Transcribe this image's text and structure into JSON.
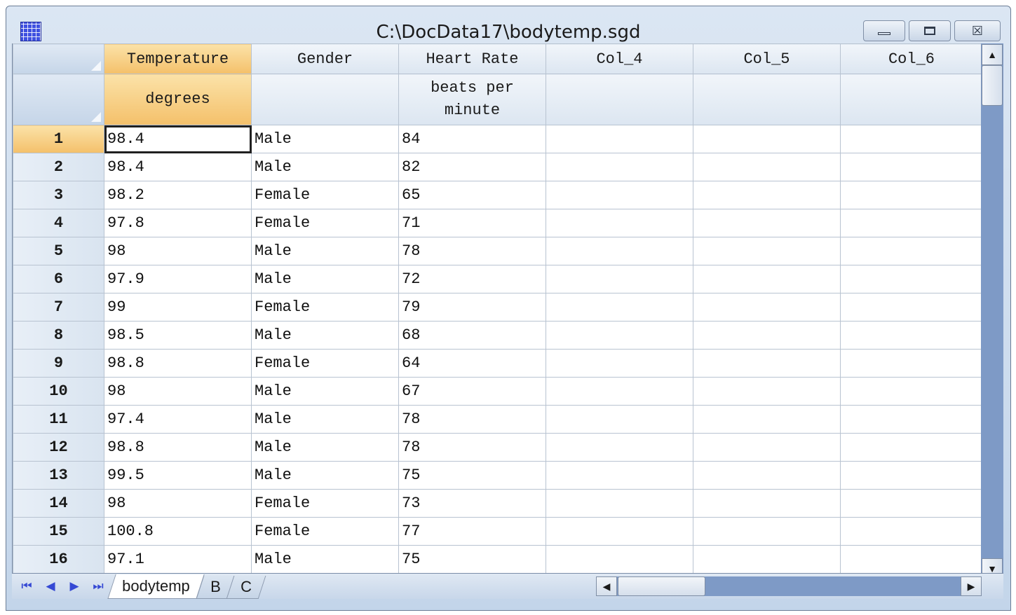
{
  "window": {
    "title": "C:\\DocData17\\bodytemp.sgd",
    "min_glyph": "▭",
    "max_glyph": "□",
    "close_glyph": "☒"
  },
  "columns": [
    {
      "name": "Temperature",
      "unit": "degrees"
    },
    {
      "name": "Gender",
      "unit": ""
    },
    {
      "name": "Heart Rate",
      "unit": "beats per minute"
    },
    {
      "name": "Col_4",
      "unit": ""
    },
    {
      "name": "Col_5",
      "unit": ""
    },
    {
      "name": "Col_6",
      "unit": ""
    }
  ],
  "rows": [
    {
      "n": "1",
      "temp": "98.4",
      "gender": "Male",
      "hr": "84"
    },
    {
      "n": "2",
      "temp": "98.4",
      "gender": "Male",
      "hr": "82"
    },
    {
      "n": "3",
      "temp": "98.2",
      "gender": "Female",
      "hr": "65"
    },
    {
      "n": "4",
      "temp": "97.8",
      "gender": "Female",
      "hr": "71"
    },
    {
      "n": "5",
      "temp": "98",
      "gender": "Male",
      "hr": "78"
    },
    {
      "n": "6",
      "temp": "97.9",
      "gender": "Male",
      "hr": "72"
    },
    {
      "n": "7",
      "temp": "99",
      "gender": "Female",
      "hr": "79"
    },
    {
      "n": "8",
      "temp": "98.5",
      "gender": "Male",
      "hr": "68"
    },
    {
      "n": "9",
      "temp": "98.8",
      "gender": "Female",
      "hr": "64"
    },
    {
      "n": "10",
      "temp": "98",
      "gender": "Male",
      "hr": "67"
    },
    {
      "n": "11",
      "temp": "97.4",
      "gender": "Male",
      "hr": "78"
    },
    {
      "n": "12",
      "temp": "98.8",
      "gender": "Male",
      "hr": "78"
    },
    {
      "n": "13",
      "temp": "99.5",
      "gender": "Male",
      "hr": "75"
    },
    {
      "n": "14",
      "temp": "98",
      "gender": "Female",
      "hr": "73"
    },
    {
      "n": "15",
      "temp": "100.8",
      "gender": "Female",
      "hr": "77"
    },
    {
      "n": "16",
      "temp": "97.1",
      "gender": "Male",
      "hr": "75"
    }
  ],
  "sheet_tabs": [
    "bodytemp",
    "B",
    "C"
  ],
  "active_tab": "bodytemp",
  "selected_cell": {
    "row": "1",
    "column": "Temperature"
  },
  "nav": {
    "first": "⏮",
    "prev": "◀",
    "next": "▶",
    "last": "⏭"
  },
  "scroll": {
    "up": "▲",
    "down": "▼",
    "left": "◀",
    "right": "▶"
  },
  "colors": {
    "active_header": "#f4c06a",
    "header_bg": "#dce6f1",
    "scroll_track": "#7e9ac6",
    "app_icon": "#3e50e0"
  }
}
